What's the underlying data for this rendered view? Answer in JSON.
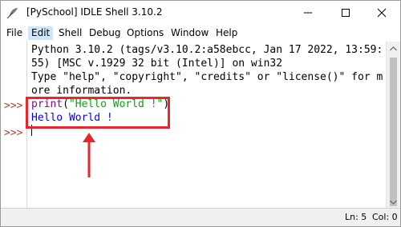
{
  "window": {
    "title": "[PySchool] IDLE Shell 3.10.2",
    "icon": "python-feather-icon"
  },
  "menu": [
    "File",
    "Edit",
    "Shell",
    "Debug",
    "Options",
    "Window",
    "Help"
  ],
  "shell": {
    "banner_lines": [
      "Python 3.10.2 (tags/v3.10.2:a58ebcc, Jan 17 2022, 13:59:",
      "55) [MSC v.1929 32 bit (Intel)] on win32",
      "Type \"help\", \"copyright\", \"credits\" or \"license()\" for m",
      "ore information."
    ],
    "prompt": ">>>",
    "command_func": "print",
    "command_open": "(",
    "command_string": "\"Hello World !\"",
    "command_close": ")",
    "output": "Hello World !"
  },
  "status": {
    "line": "Ln: 5",
    "col": "Col: 0"
  },
  "colors": {
    "annotation": "#e8262b",
    "prompt": "#c0392b",
    "keyword": "#900090",
    "string": "#00aa00",
    "output": "#0000ff",
    "menu_active": "#cce8ff"
  }
}
